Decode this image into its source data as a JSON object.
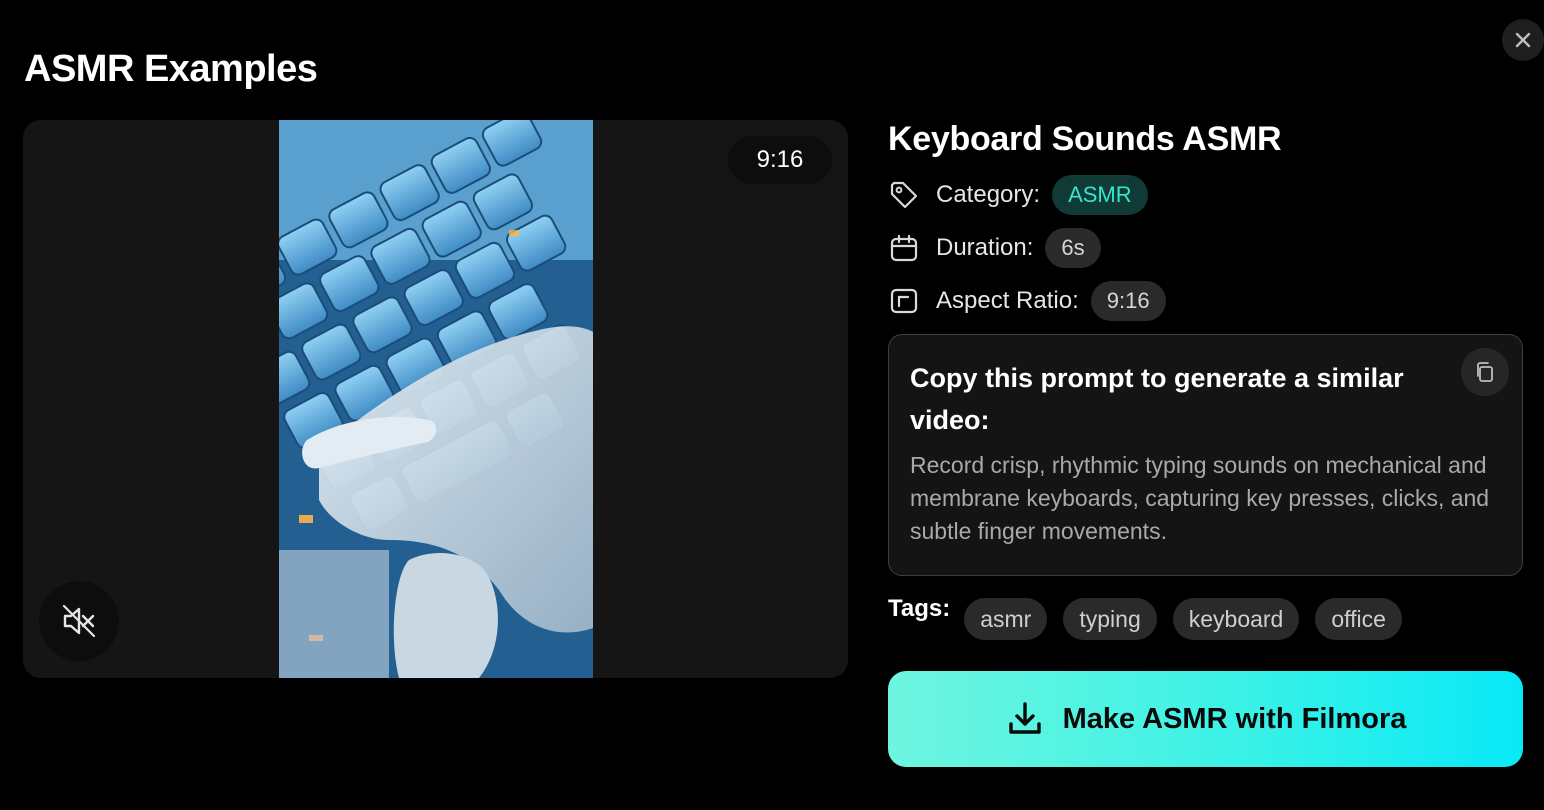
{
  "modal": {
    "title": "ASMR Examples"
  },
  "video": {
    "ratio_badge": "9:16",
    "muted": true
  },
  "details": {
    "title": "Keyboard Sounds ASMR",
    "category_label": "Category:",
    "category_value": "ASMR",
    "duration_label": "Duration:",
    "duration_value": "6s",
    "aspect_label": "Aspect Ratio:",
    "aspect_value": "9:16"
  },
  "prompt": {
    "heading": "Copy this prompt to generate a similar video:",
    "text": "Record crisp, rhythmic typing sounds on mechanical and membrane keyboards, capturing key presses, clicks, and subtle finger movements."
  },
  "tags": {
    "label": "Tags:",
    "items": [
      "asmr",
      "typing",
      "keyboard",
      "office"
    ]
  },
  "cta": {
    "label": "Make ASMR with Filmora"
  },
  "icons": {
    "close": "close-icon",
    "mute": "speaker-muted-icon",
    "category": "tag-icon",
    "duration": "calendar-icon",
    "aspect": "aspect-ratio-icon",
    "copy": "copy-icon",
    "download": "download-icon"
  },
  "colors": {
    "accent": "#37e5cc",
    "cta_start": "#6ff5df",
    "cta_end": "#08e9f7"
  }
}
